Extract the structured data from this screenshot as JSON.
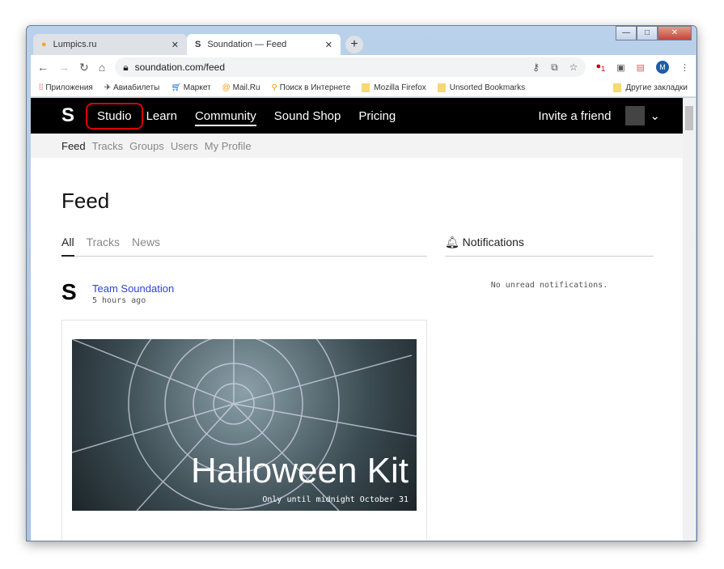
{
  "browser": {
    "tabs": [
      {
        "title": "Lumpics.ru",
        "active": false
      },
      {
        "title": "Soundation — Feed",
        "active": true
      }
    ],
    "url": "soundation.com/feed",
    "bookmarks": [
      "Приложения",
      "Авиабилеты",
      "Маркет",
      "Mail.Ru",
      "Поиск в Интернете",
      "Mozilla Firefox",
      "Unsorted Bookmarks"
    ],
    "other_bookmarks": "Другие закладки",
    "profile_initial": "M",
    "adblock_count": "1"
  },
  "nav": {
    "items": [
      "Studio",
      "Learn",
      "Community",
      "Sound Shop",
      "Pricing"
    ],
    "active": "Community",
    "highlighted": "Studio",
    "invite": "Invite a friend"
  },
  "subnav": {
    "items": [
      "Feed",
      "Tracks",
      "Groups",
      "Users",
      "My Profile"
    ],
    "active": "Feed"
  },
  "main": {
    "title": "Feed",
    "tabs": [
      "All",
      "Tracks",
      "News"
    ],
    "active_tab": "All",
    "notifications": {
      "title": "Notifications",
      "empty": "No unread notifications."
    },
    "post": {
      "author": "Team Soundation",
      "time": "5 hours ago",
      "image_title": "Halloween Kit",
      "image_subtitle": "Only until midnight October 31"
    }
  }
}
